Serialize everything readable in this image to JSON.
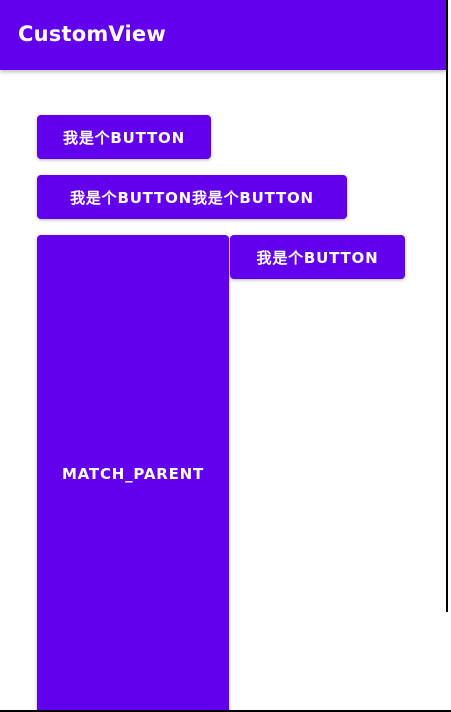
{
  "app_bar": {
    "title": "CustomView",
    "color": "#6200EE"
  },
  "buttons": [
    {
      "label": "我是个BUTTON"
    },
    {
      "label": "我是个BUTTON我是个BUTTON"
    },
    {
      "label": "MATCH_PARENT"
    },
    {
      "label": "我是个BUTTON"
    }
  ],
  "colors": {
    "primary": "#6200EE",
    "on_primary": "#FFFFFF",
    "background": "#FFFFFF"
  }
}
